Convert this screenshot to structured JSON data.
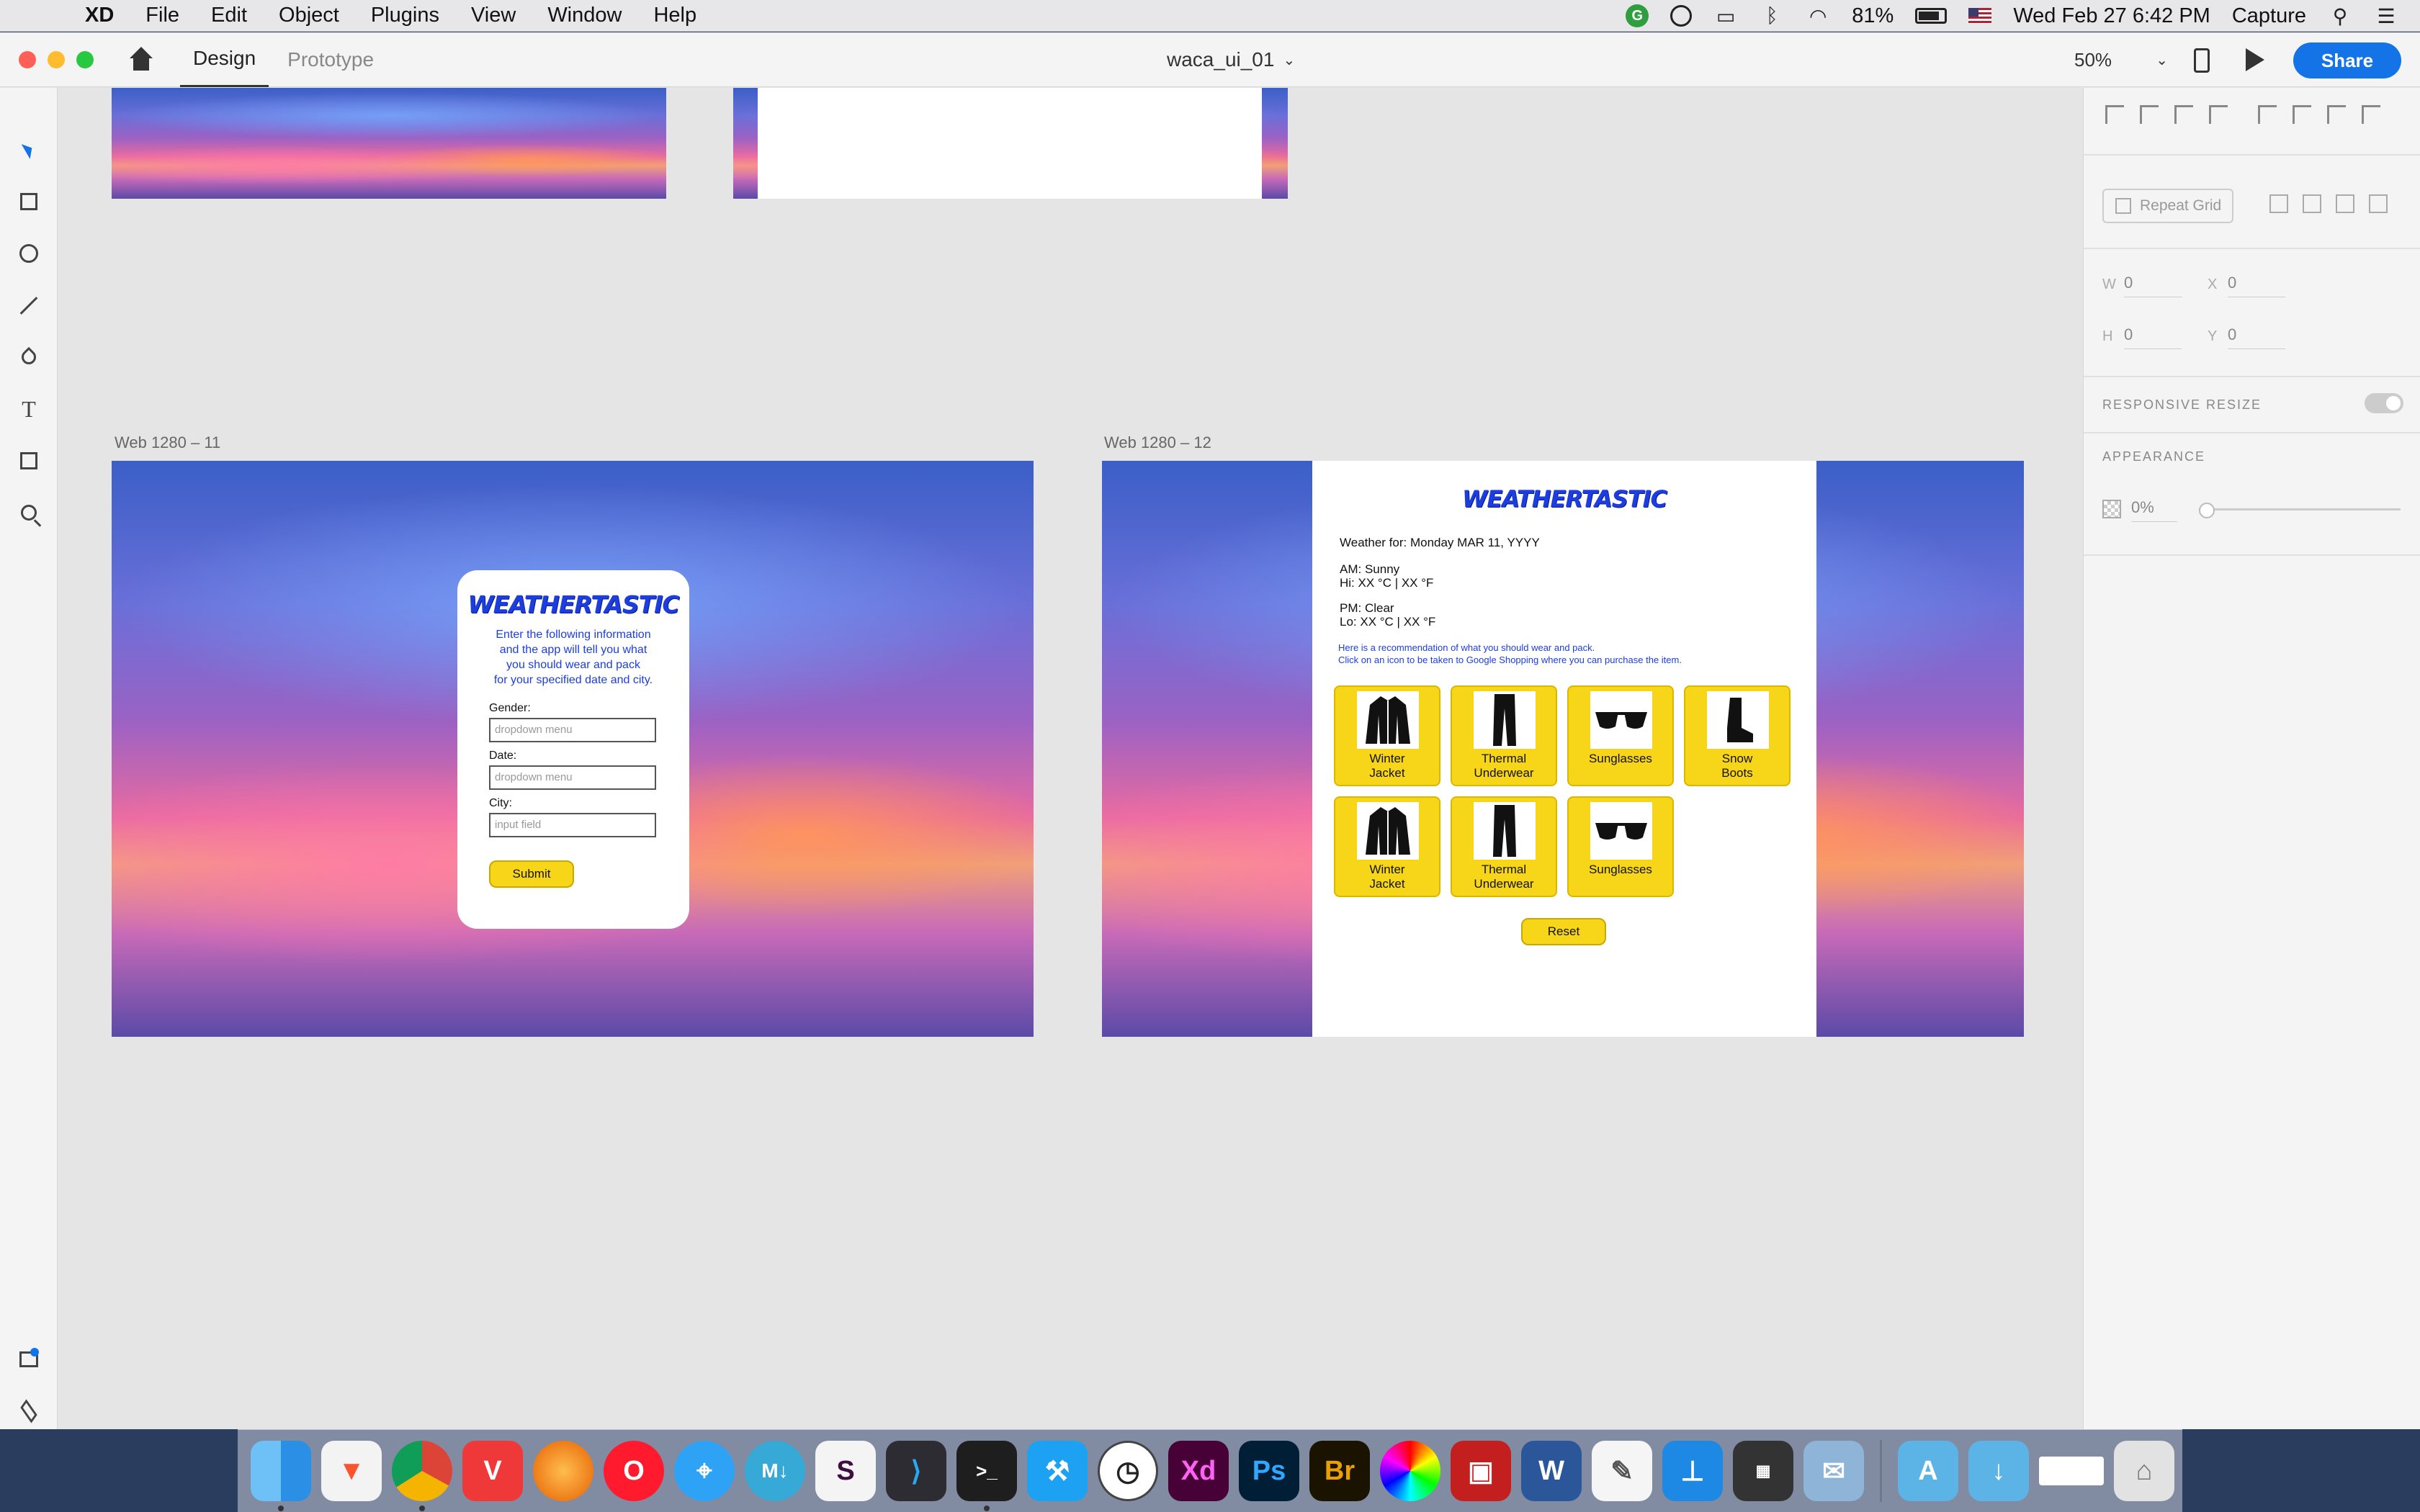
{
  "menubar": {
    "app": "XD",
    "menus": [
      "File",
      "Edit",
      "Object",
      "Plugins",
      "View",
      "Window",
      "Help"
    ],
    "battery": "81%",
    "datetime": "Wed Feb 27  6:42 PM",
    "capture": "Capture"
  },
  "titlebar": {
    "tabs": {
      "design": "Design",
      "prototype": "Prototype"
    },
    "document": "waca_ui_01",
    "zoom": "50%",
    "share": "Share"
  },
  "artboards": {
    "a11_label": "Web 1280 – 11",
    "a12_label": "Web 1280 – 12"
  },
  "form": {
    "logo": "WEATHERTASTIC",
    "intro": [
      "Enter the following information",
      "and the app will tell you what",
      "you should wear and pack",
      "for your specified date and city."
    ],
    "gender_label": "Gender:",
    "gender_placeholder": "dropdown menu",
    "date_label": "Date:",
    "date_placeholder": "dropdown menu",
    "city_label": "City:",
    "city_placeholder": "input field",
    "submit": "Submit"
  },
  "result": {
    "logo": "WEATHERTASTIC",
    "weather_for": "Weather for: Monday MAR 11, YYYY",
    "am": "AM: Sunny",
    "am_temp": "Hi: XX °C | XX °F",
    "pm": "PM: Clear",
    "pm_temp": "Lo: XX °C | XX °F",
    "rec1": "Here is a recommendation of what you should wear and pack.",
    "rec2": "Click on an icon to be taken to Google Shopping where you can purchase the item.",
    "items": [
      {
        "line1": "Winter",
        "line2": "Jacket",
        "icon": "jacket-icon"
      },
      {
        "line1": "Thermal",
        "line2": "Underwear",
        "icon": "pants-icon"
      },
      {
        "line1": "Sunglasses",
        "line2": "",
        "icon": "sunglasses-icon"
      },
      {
        "line1": "Snow",
        "line2": "Boots",
        "icon": "boot-icon"
      },
      {
        "line1": "Winter",
        "line2": "Jacket",
        "icon": "jacket-icon"
      },
      {
        "line1": "Thermal",
        "line2": "Underwear",
        "icon": "pants-icon"
      },
      {
        "line1": "Sunglasses",
        "line2": "",
        "icon": "sunglasses-icon"
      }
    ],
    "reset": "Reset"
  },
  "inspector": {
    "repeat_grid": "Repeat Grid",
    "w_label": "W",
    "w": "0",
    "h_label": "H",
    "h": "0",
    "x_label": "X",
    "x": "0",
    "y_label": "Y",
    "y": "0",
    "responsive_resize": "RESPONSIVE RESIZE",
    "appearance": "APPEARANCE",
    "opacity": "0%"
  },
  "dock": {
    "apps": [
      "Finder",
      "Brave",
      "Chrome",
      "Vivaldi",
      "Firefox",
      "Opera",
      "Safari",
      "MacDown",
      "Slack",
      "VS Code",
      "Terminal",
      "Xcode",
      "Clock",
      "Xd",
      "Ps",
      "Br",
      "Color Picker",
      "Photo Booth",
      "Word",
      "TextEdit",
      "Keynote",
      "Calendar",
      "Preview"
    ],
    "xd_label": "Xd",
    "ps_label": "Ps",
    "br_label": "Br",
    "word_label": "W"
  },
  "colors": {
    "accent": "#1473e6",
    "logo_blue": "#1c3de0",
    "button_yellow": "#f7d518",
    "canvas": "#e5e5e5"
  }
}
